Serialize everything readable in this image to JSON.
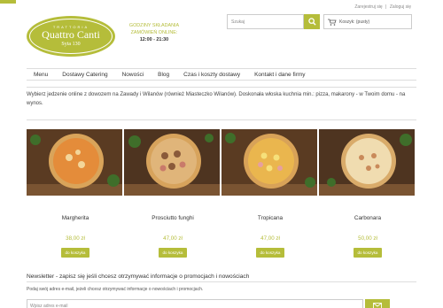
{
  "top_links": {
    "register": "Zarejestruj się",
    "separator": "|",
    "login": "Zaloguj się"
  },
  "logo": {
    "small_text": "TRATTORIA",
    "name": "Quattro Canti",
    "address": "Syta 130"
  },
  "hours": {
    "line1": "Godziny składania",
    "line2": "zamówień online:",
    "time": "12:00 - 21:30"
  },
  "search": {
    "placeholder": "Szukaj",
    "icon": "search-icon"
  },
  "cart": {
    "label": "Koszyk: (pusty)",
    "icon": "cart-icon"
  },
  "nav": {
    "items": [
      "Menu",
      "Dostawy Catering",
      "Nowości",
      "Blog",
      "Czas i koszty dostawy",
      "Kontakt i dane firmy"
    ]
  },
  "intro": {
    "text": "Wybierz jedzenie online z dowozem na Zawady i Wilanów (również Miasteczko Wilanów). Doskonała włoska kuchnia min.: pizza, makarony - w Twoim domu - na wynos."
  },
  "products": [
    {
      "name": "Margherita",
      "price": "38,00 zł",
      "button": "do koszyka"
    },
    {
      "name": "Prosciutto funghi",
      "price": "47,00 zł",
      "button": "do koszyka"
    },
    {
      "name": "Tropicana",
      "price": "47,00 zł",
      "button": "do koszyka"
    },
    {
      "name": "Carbonara",
      "price": "50,00 zł",
      "button": "do koszyka"
    }
  ],
  "newsletter": {
    "title": "Newsletter - zapisz się jeśli chcesz otrzymywać informacje o promocjach i nowościach",
    "description": "Podaj swój adres e-mail, jeżeli chcesz otrzymywać informacje o nowościach i promocjach.",
    "email_placeholder": "Wpisz adres e-mail",
    "send_icon": "envelope-icon"
  },
  "colors": {
    "accent": "#b5bd3a",
    "text": "#333333",
    "border": "#dddddd"
  }
}
